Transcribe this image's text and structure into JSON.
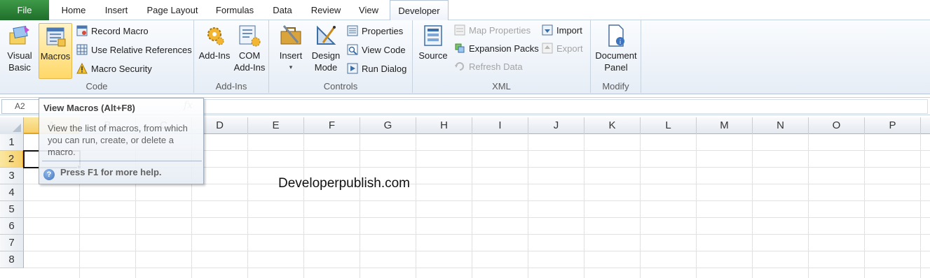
{
  "tabs": [
    {
      "label": "File"
    },
    {
      "label": "Home"
    },
    {
      "label": "Insert"
    },
    {
      "label": "Page Layout"
    },
    {
      "label": "Formulas"
    },
    {
      "label": "Data"
    },
    {
      "label": "Review"
    },
    {
      "label": "View"
    },
    {
      "label": "Developer"
    }
  ],
  "ribbon": {
    "code": {
      "label": "Code",
      "visual_basic": "Visual\nBasic",
      "macros": "Macros",
      "record_macro": "Record Macro",
      "relative_refs": "Use Relative References",
      "macro_security": "Macro Security"
    },
    "addins": {
      "label": "Add-Ins",
      "addins_btn": "Add-Ins",
      "com_addins": "COM\nAdd-Ins"
    },
    "controls": {
      "label": "Controls",
      "insert": "Insert",
      "design_mode": "Design\nMode",
      "properties": "Properties",
      "view_code": "View Code",
      "run_dialog": "Run Dialog"
    },
    "xml": {
      "label": "XML",
      "source": "Source",
      "map_properties": "Map Properties",
      "expansion_packs": "Expansion Packs",
      "refresh_data": "Refresh Data",
      "import": "Import",
      "export": "Export"
    },
    "modify": {
      "label": "Modify",
      "document_panel": "Document\nPanel"
    }
  },
  "formula_bar": {
    "name_box": "A2",
    "fx": "fx",
    "value": ""
  },
  "grid": {
    "columns": [
      "A",
      "B",
      "C",
      "D",
      "E",
      "F",
      "G",
      "H",
      "I",
      "J",
      "K",
      "L",
      "M",
      "N",
      "O",
      "P"
    ],
    "rows": [
      "1",
      "2",
      "3",
      "4",
      "5",
      "6",
      "7",
      "8"
    ],
    "selected_column": "A",
    "selected_row": "2",
    "watermark": "Developerpublish.com"
  },
  "tooltip": {
    "title": "View Macros (Alt+F8)",
    "body": "View the list of macros, from which you can run, create, or delete a macro.",
    "help": "Press F1 for more help."
  }
}
